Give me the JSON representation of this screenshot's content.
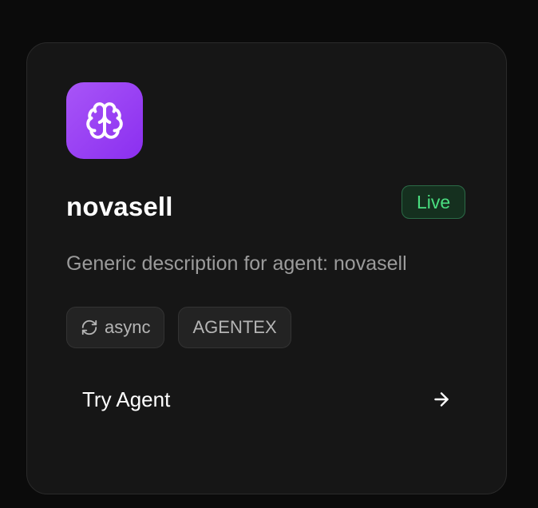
{
  "agent": {
    "name": "novasell",
    "status": "Live",
    "description": "Generic description for agent: novasell",
    "logo_icon": "brain-icon"
  },
  "tags": [
    {
      "icon": "refresh-icon",
      "label": "async"
    },
    {
      "label": "AGENTEX"
    }
  ],
  "action": {
    "label": "Try Agent",
    "icon": "arrow-right-icon"
  },
  "colors": {
    "accent": "#a855f7",
    "status_text": "#4ade80",
    "status_bg": "#15301f",
    "card_bg": "#161616"
  }
}
